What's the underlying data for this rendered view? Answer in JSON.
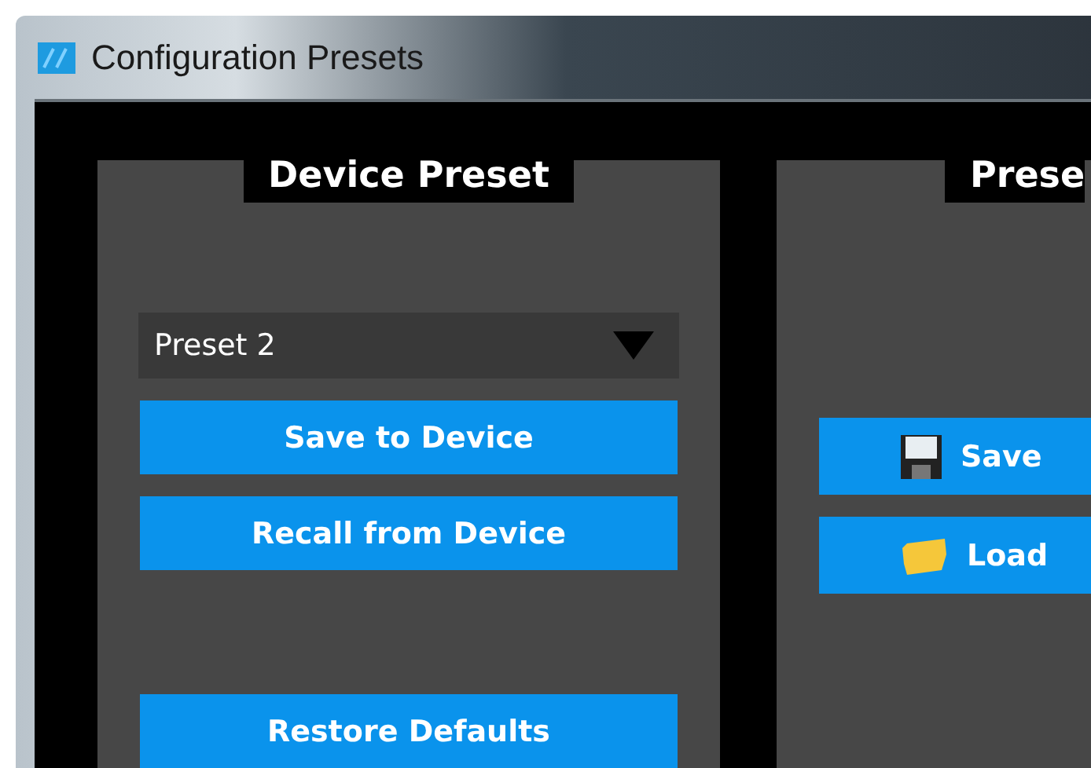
{
  "window": {
    "title": "Configuration Presets"
  },
  "device_preset": {
    "heading": "Device Preset",
    "dropdown": {
      "value": "Preset 2"
    },
    "buttons": [
      {
        "label": "Save to Device"
      },
      {
        "label": "Recall from Device"
      },
      {
        "label": "Restore Defaults"
      }
    ]
  },
  "file_preset": {
    "heading": "Prese",
    "buttons": [
      {
        "label": "Save",
        "kind": "save"
      },
      {
        "label": "Load",
        "kind": "load"
      }
    ]
  }
}
